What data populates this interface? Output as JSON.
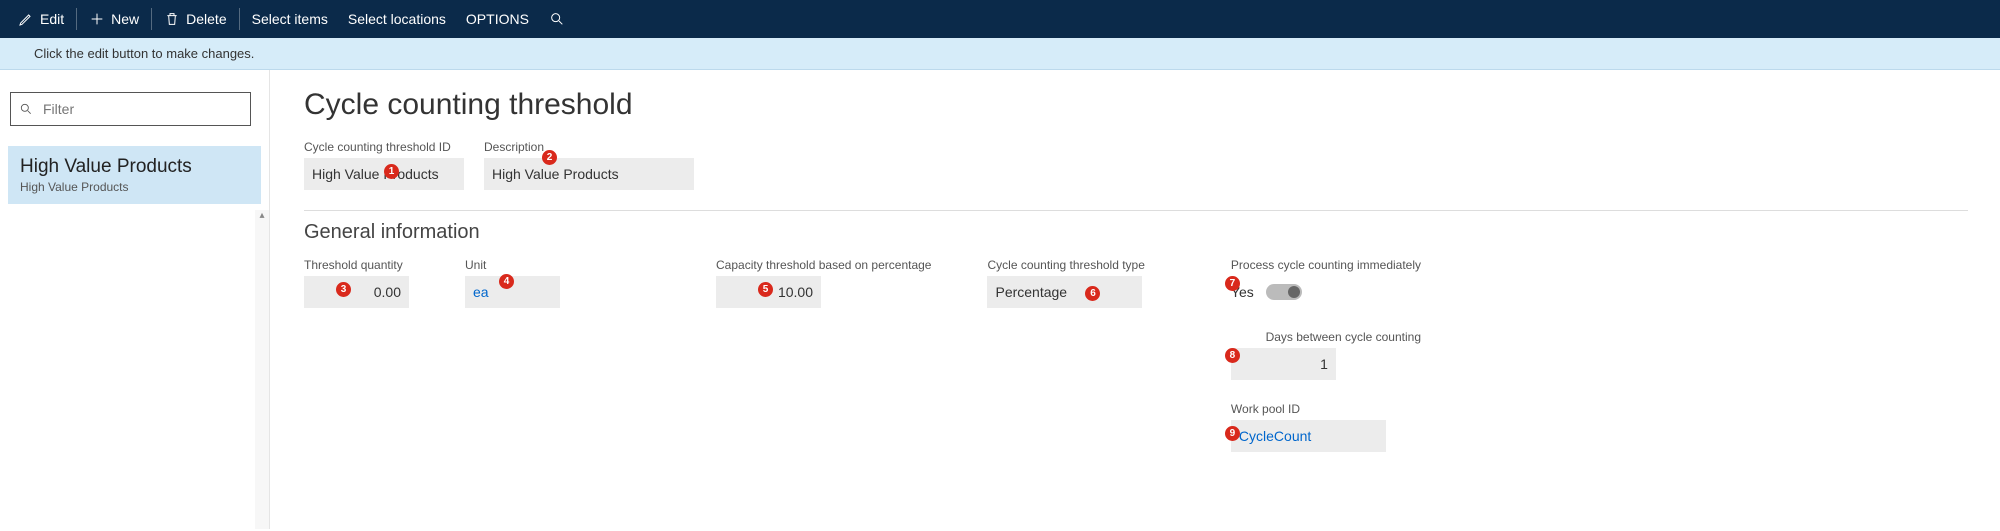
{
  "toolbar": {
    "edit": "Edit",
    "new": "New",
    "delete": "Delete",
    "select_items": "Select items",
    "select_locations": "Select locations",
    "options": "OPTIONS"
  },
  "infobar": "Click the edit button to make changes.",
  "filter": {
    "placeholder": "Filter"
  },
  "sidebar": {
    "items": [
      {
        "title": "High Value Products",
        "sub": "High Value Products"
      }
    ]
  },
  "page": {
    "title": "Cycle counting threshold",
    "header_fields": {
      "id": {
        "label": "Cycle counting threshold ID",
        "value": "High Value Products"
      },
      "desc": {
        "label": "Description",
        "value": "High Value Products"
      }
    },
    "section": "General information",
    "general": {
      "threshold_qty": {
        "label": "Threshold quantity",
        "value": "0.00"
      },
      "unit": {
        "label": "Unit",
        "value": "ea"
      },
      "capacity_pct": {
        "label": "Capacity threshold based on percentage",
        "value": "10.00"
      },
      "type": {
        "label": "Cycle counting threshold type",
        "value": "Percentage"
      },
      "process_immediate": {
        "label": "Process cycle counting immediately",
        "value": "Yes"
      },
      "days_between": {
        "label": "Days between cycle counting",
        "value": "1"
      },
      "work_pool": {
        "label": "Work pool ID",
        "value": "CycleCount"
      }
    }
  },
  "badges": [
    "1",
    "2",
    "3",
    "4",
    "5",
    "6",
    "7",
    "8",
    "9"
  ]
}
